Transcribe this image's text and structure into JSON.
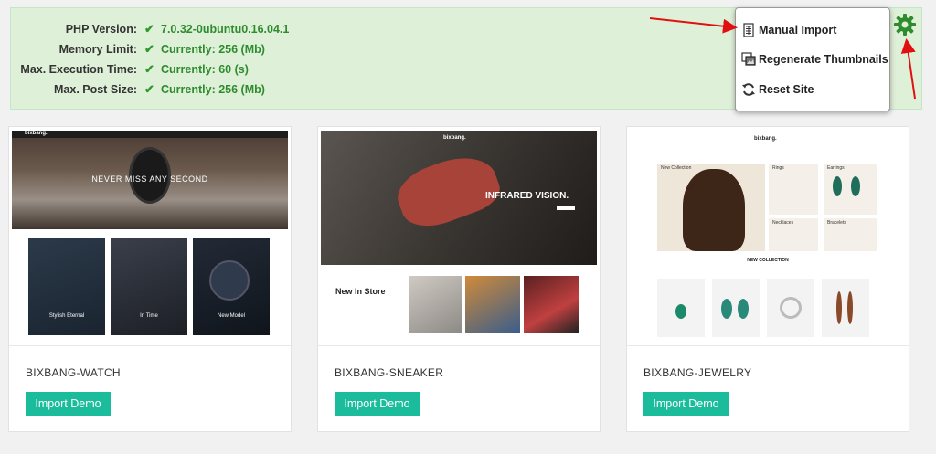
{
  "system_info": {
    "rows": [
      {
        "label": "PHP Version:",
        "value": "7.0.32-0ubuntu0.16.04.1"
      },
      {
        "label": "Memory Limit:",
        "value": "Currently: 256 (Mb)"
      },
      {
        "label": "Max. Execution Time:",
        "value": "Currently: 60 (s)"
      },
      {
        "label": "Max. Post Size:",
        "value": "Currently: 256 (Mb)"
      }
    ]
  },
  "menu": {
    "items": [
      {
        "label": "Manual Import",
        "icon": "document-icon"
      },
      {
        "label": "Regenerate Thumbnails",
        "icon": "images-icon"
      },
      {
        "label": "Reset Site",
        "icon": "refresh-icon"
      }
    ]
  },
  "demos": [
    {
      "name": "BIXBANG-WATCH",
      "button": "Import Demo",
      "preview": {
        "logo": "bixbang.",
        "hero_text": "NEVER MISS ANY SECOND",
        "tiles": [
          "Stylish Eternal",
          "In Time",
          "New Model"
        ]
      }
    },
    {
      "name": "BIXBANG-SNEAKER",
      "button": "Import Demo",
      "preview": {
        "logo": "bixbang.",
        "hero_text": "INFRARED VISION.",
        "side_text": "New In Store"
      }
    },
    {
      "name": "BIXBANG-JEWELRY",
      "button": "Import Demo",
      "preview": {
        "logo": "bixbang.",
        "hero_text": "New Collection",
        "tiles": [
          "Rings",
          "Earrings",
          "Necklaces",
          "Bracelets"
        ],
        "section_title": "NEW COLLECTION"
      }
    }
  ],
  "colors": {
    "panel_bg": "#dff0d8",
    "value_green": "#2e8b2e",
    "button_teal": "#1abc9c",
    "gear_green": "#2e8b2e",
    "arrow_red": "#e01010"
  }
}
